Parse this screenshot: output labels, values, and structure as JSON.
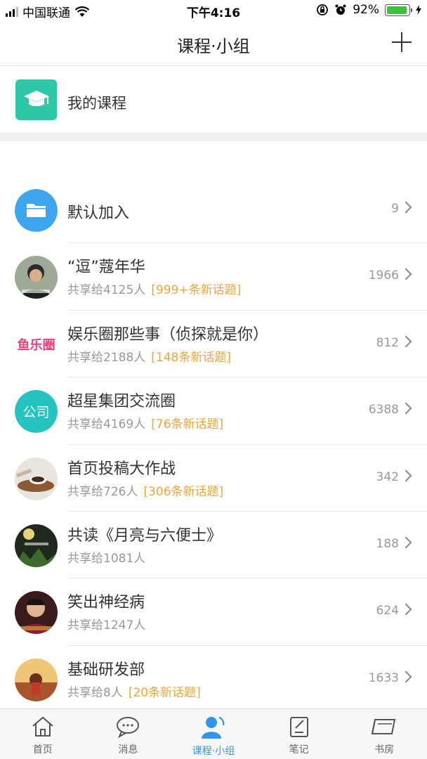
{
  "status_bar": {
    "carrier": "中国联通",
    "time": "下午4:16",
    "battery_percent": "92%",
    "battery_level": 0.92
  },
  "nav": {
    "title": "课程·小组"
  },
  "my_course": {
    "label": "我的课程",
    "icon": "graduation-cap-icon",
    "icon_color": "#2ec7a7"
  },
  "groups": [
    {
      "title": "默认加入",
      "count": "9",
      "shared": "",
      "tag": "",
      "avatar": "folder-icon",
      "avatar_color": "#3ea5ef"
    },
    {
      "title": "“逗”蔻年华",
      "count": "1966",
      "shared": "共享给4125人",
      "tag": "[999+条新话题]",
      "avatar": "photo-man",
      "avatar_color": "#4d5a4a"
    },
    {
      "title": "娱乐圈那些事（侦探就是你）",
      "count": "812",
      "shared": "共享给2188人",
      "tag": "[148条新话题]",
      "avatar": "logo-yulequan",
      "avatar_color": "#e8407a",
      "avatar_text": "鱼乐圈"
    },
    {
      "title": "超星集团交流圈",
      "count": "6388",
      "shared": "共享给4169人",
      "tag": "[76条新话题]",
      "avatar": "badge-company",
      "avatar_color": "#26c3c0",
      "avatar_text": "公司"
    },
    {
      "title": "首页投稿大作战",
      "count": "342",
      "shared": "共享给726人",
      "tag": "[306条新话题]",
      "avatar": "photo-coffee",
      "avatar_color": "#c7a27e"
    },
    {
      "title": "共读《月亮与六便士》",
      "count": "188",
      "shared": "共享给1081人",
      "tag": "",
      "avatar": "photo-book",
      "avatar_color": "#2c3a2a"
    },
    {
      "title": "笑出神经病",
      "count": "624",
      "shared": "共享给1247人",
      "tag": "",
      "avatar": "photo-comedian",
      "avatar_color": "#6a2a2a"
    },
    {
      "title": "基础研发部",
      "count": "1633",
      "shared": "共享给8人",
      "tag": "[20条新话题]",
      "avatar": "photo-sunset",
      "avatar_color": "#d89a3a"
    }
  ],
  "tabs": [
    {
      "label": "首页",
      "icon": "home-icon",
      "active": false
    },
    {
      "label": "消息",
      "icon": "message-icon",
      "active": false
    },
    {
      "label": "课程·小组",
      "icon": "person-icon",
      "active": true
    },
    {
      "label": "笔记",
      "icon": "note-icon",
      "active": false
    },
    {
      "label": "书房",
      "icon": "bookshelf-icon",
      "active": false
    }
  ],
  "colors": {
    "accent": "#2f98e5",
    "tag": "#f0a53a",
    "muted": "#999999"
  }
}
